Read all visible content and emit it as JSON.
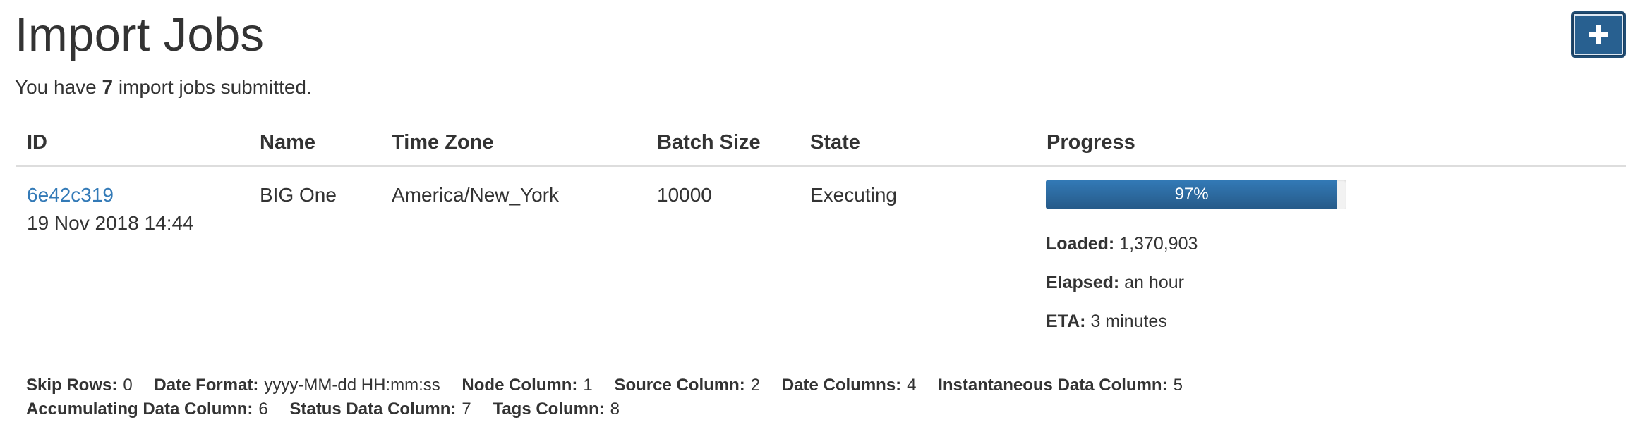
{
  "page": {
    "title": "Import Jobs",
    "add_button_icon": "plus-icon",
    "summary_prefix": "You have ",
    "summary_count": "7",
    "summary_suffix": " import jobs submitted."
  },
  "table": {
    "headers": {
      "id": "ID",
      "name": "Name",
      "timezone": "Time Zone",
      "batch_size": "Batch Size",
      "state": "State",
      "progress": "Progress"
    },
    "rows": [
      {
        "id": "6e42c319",
        "date": "19 Nov 2018 14:44",
        "name": "BIG One",
        "timezone": "America/New_York",
        "batch_size": "10000",
        "state": "Executing",
        "progress_label": "97%",
        "progress_fraction": 0.97,
        "loaded_label": "Loaded:",
        "loaded_value": "1,370,903",
        "elapsed_label": "Elapsed:",
        "elapsed_value": "an hour",
        "eta_label": "ETA:",
        "eta_value": "3 minutes"
      }
    ]
  },
  "config": {
    "skip_rows_label": "Skip Rows:",
    "skip_rows_value": "0",
    "date_format_label": "Date Format:",
    "date_format_value": "yyyy-MM-dd HH:mm:ss",
    "node_column_label": "Node Column:",
    "node_column_value": "1",
    "source_column_label": "Source Column:",
    "source_column_value": "2",
    "date_columns_label": "Date Columns:",
    "date_columns_value": "4",
    "instantaneous_label": "Instantaneous Data Column:",
    "instantaneous_value": "5",
    "accumulating_label": "Accumulating Data Column:",
    "accumulating_value": "6",
    "status_label": "Status Data Column:",
    "status_value": "7",
    "tags_label": "Tags Column:",
    "tags_value": "8"
  },
  "colors": {
    "primary": "#286090",
    "link": "#337ab7",
    "text": "#333333",
    "divider": "#dddddd"
  }
}
